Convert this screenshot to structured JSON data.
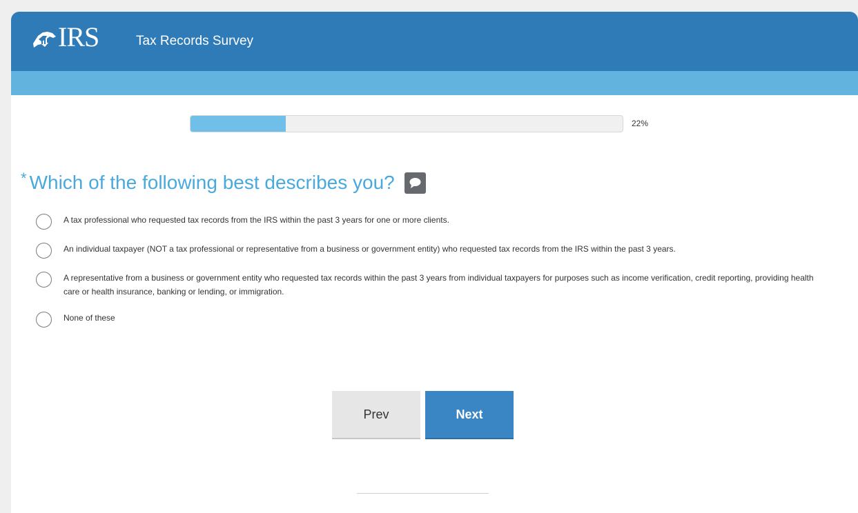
{
  "header": {
    "logo_text": "IRS",
    "app_title": "Tax Records Survey",
    "colors": {
      "bar": "#2e7bb8",
      "subbar": "#62b3dd"
    }
  },
  "progress": {
    "value": 0.22,
    "label": "22%"
  },
  "question": {
    "required_mark": "*",
    "text": "Which of the following best describes you?",
    "comment_icon": "comment-icon"
  },
  "options": [
    "A tax professional who requested tax records from the IRS within the past 3 years for one or more clients.",
    "An individual taxpayer (NOT a tax professional or representative from a business or government entity) who requested tax records from the IRS within the past 3 years.",
    "A representative from a business or government entity who requested tax records within the past 3 years from individual taxpayers for purposes such as income verification, credit reporting, providing health care or health insurance, banking or lending, or immigration.",
    "None of these"
  ],
  "navigation": {
    "prev_label": "Prev",
    "next_label": "Next"
  }
}
